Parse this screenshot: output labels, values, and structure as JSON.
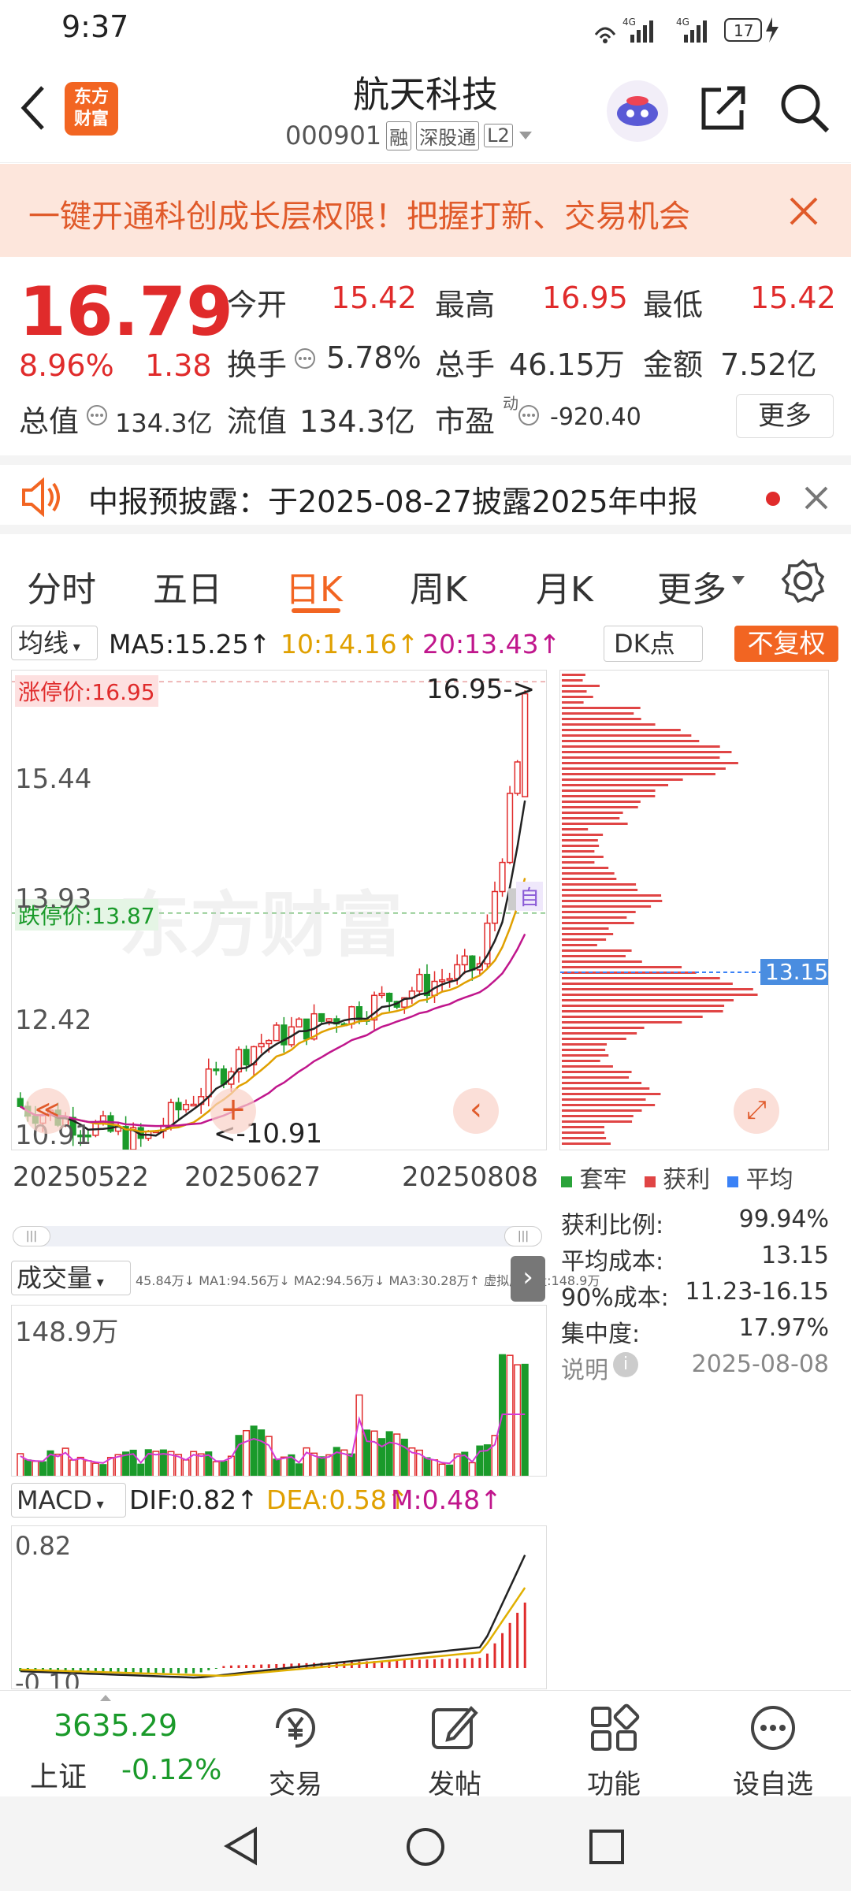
{
  "status": {
    "time": "9:37",
    "net1": "4G",
    "net2": "4G",
    "battery": "17"
  },
  "nav": {
    "logo_top": "东方",
    "logo_bottom": "财富",
    "title": "航天科技",
    "code": "000901",
    "badges": [
      "融",
      "深股通",
      "L2"
    ]
  },
  "banner": {
    "text": "一键开通科创成长层权限！把握打新、交易机会"
  },
  "quote": {
    "price": "16.79",
    "change_pct": "8.96%",
    "change": "1.38",
    "open_label": "今开",
    "open": "15.42",
    "high_label": "最高",
    "high": "16.95",
    "low_label": "最低",
    "low": "15.42",
    "turnover_label": "换手",
    "turnover": "5.78%",
    "volume_label": "总手",
    "volume": "46.15万",
    "amount_label": "金额",
    "amount": "7.52亿",
    "mktcap_label": "总值",
    "mktcap": "134.3亿",
    "float_label": "流值",
    "float": "134.3亿",
    "pe_label": "市盈",
    "pe_sup": "动",
    "pe": "-920.40",
    "more": "更多"
  },
  "notice": {
    "text": "中报预披露：于2025-08-27披露2025年中报"
  },
  "tabs": [
    "分时",
    "五日",
    "日K",
    "周K",
    "月K",
    "更多"
  ],
  "tabs_active": "日K",
  "kline": {
    "ma_selector": "均线",
    "ma5": "MA5:15.25↑",
    "ma10": "10:14.16↑",
    "ma20": "20:13.43↑",
    "dk": "DK点",
    "fq": "不复权",
    "limit_up": "涨停价:16.95",
    "limit_down": "跌停价:13.87",
    "y_labels": [
      "15.44",
      "13.93",
      "12.42",
      "10.91"
    ],
    "high_mark": "16.95->",
    "low_mark": "<-10.91",
    "dates": [
      "20250522",
      "20250627",
      "20250808"
    ],
    "watermark": "东方财富",
    "self_mark": "自",
    "chip_avg": "13.15"
  },
  "chips": {
    "legend": [
      "套牢",
      "获利",
      "平均"
    ],
    "rows": [
      {
        "label": "获利比例:",
        "value": "99.94%"
      },
      {
        "label": "平均成本:",
        "value": "13.15"
      },
      {
        "label": "90%成本:",
        "value": "11.23-16.15"
      },
      {
        "label": "集中度:",
        "value": "17.97%"
      }
    ],
    "note": "说明",
    "date": "2025-08-08"
  },
  "volume": {
    "selector": "成交量",
    "line": "45.84万↓ MA1:94.56万↓ MA2:94.56万↓ MA3:30.28万↑ 虚拟成交量:148.9万",
    "max": "148.9万"
  },
  "macd": {
    "selector": "MACD",
    "dif": "DIF:0.82↑",
    "dea": "DEA:0.58↑",
    "m": "M:0.48↑",
    "top": "0.82",
    "bottom": "-0.10"
  },
  "bottom": {
    "index_value": "3635.29",
    "index_name": "上证",
    "index_change": "-0.12%",
    "items": [
      "交易",
      "发帖",
      "功能",
      "设自选"
    ]
  },
  "colors": {
    "up": "#e02b2b",
    "down": "#1a9a2a",
    "accent": "#f26522",
    "avg": "#3b82f6"
  }
}
